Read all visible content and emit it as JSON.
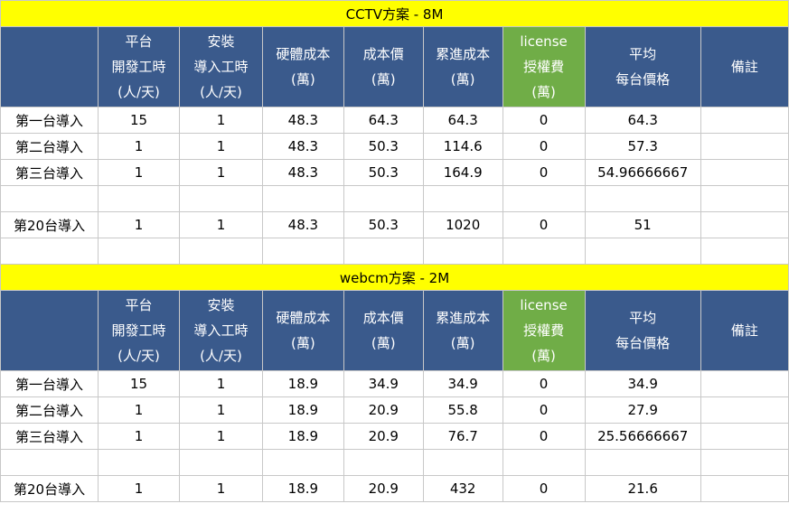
{
  "colors": {
    "title_background": "#ffff00",
    "header_background": "#3a5a8c",
    "license_header_background": "#70ad47",
    "highlight_text": "#ff0000"
  },
  "headers": {
    "platform_dev": [
      "平台",
      "開發工時",
      "(人/天)"
    ],
    "install": [
      "安裝",
      "導入工時",
      "(人/天)"
    ],
    "hardware": [
      "硬體成本",
      "(萬)"
    ],
    "cost": [
      "成本價",
      "(萬)"
    ],
    "cumulative": [
      "累進成本",
      "(萬)"
    ],
    "license": [
      "license",
      "授權費",
      "(萬)"
    ],
    "average": [
      "平均",
      "每台價格"
    ],
    "notes": "備註"
  },
  "sections": [
    {
      "title": "CCTV方案 - 8M",
      "rows": [
        {
          "label": "第一台導入",
          "dev": "15",
          "install": "1",
          "hardware": "48.3",
          "cost": "64.3",
          "cumulative": "64.3",
          "license": "0",
          "average": "64.3",
          "notes": ""
        },
        {
          "label": "第二台導入",
          "dev": "1",
          "install": "1",
          "hardware": "48.3",
          "cost": "50.3",
          "cumulative": "114.6",
          "license": "0",
          "average": "57.3",
          "notes": ""
        },
        {
          "label": "第三台導入",
          "dev": "1",
          "install": "1",
          "hardware": "48.3",
          "cost": "50.3",
          "cumulative": "164.9",
          "license": "0",
          "average": "54.96666667",
          "notes": ""
        },
        {
          "label": "第20台導入",
          "dev": "1",
          "install": "1",
          "hardware": "48.3",
          "cost": "50.3",
          "cumulative": "1020",
          "license": "0",
          "average": "51",
          "notes": ""
        }
      ]
    },
    {
      "title": "webcm方案 - 2M",
      "rows": [
        {
          "label": "第一台導入",
          "dev": "15",
          "install": "1",
          "hardware": "18.9",
          "cost": "34.9",
          "cumulative": "34.9",
          "license": "0",
          "average": "34.9",
          "notes": ""
        },
        {
          "label": "第二台導入",
          "dev": "1",
          "install": "1",
          "hardware": "18.9",
          "cost": "20.9",
          "cumulative": "55.8",
          "license": "0",
          "average": "27.9",
          "notes": ""
        },
        {
          "label": "第三台導入",
          "dev": "1",
          "install": "1",
          "hardware": "18.9",
          "cost": "20.9",
          "cumulative": "76.7",
          "license": "0",
          "average": "25.56666667",
          "notes": ""
        },
        {
          "label": "第20台導入",
          "dev": "1",
          "install": "1",
          "hardware": "18.9",
          "cost": "20.9",
          "cumulative": "432",
          "license": "0",
          "average": "21.6",
          "notes": ""
        }
      ]
    }
  ]
}
